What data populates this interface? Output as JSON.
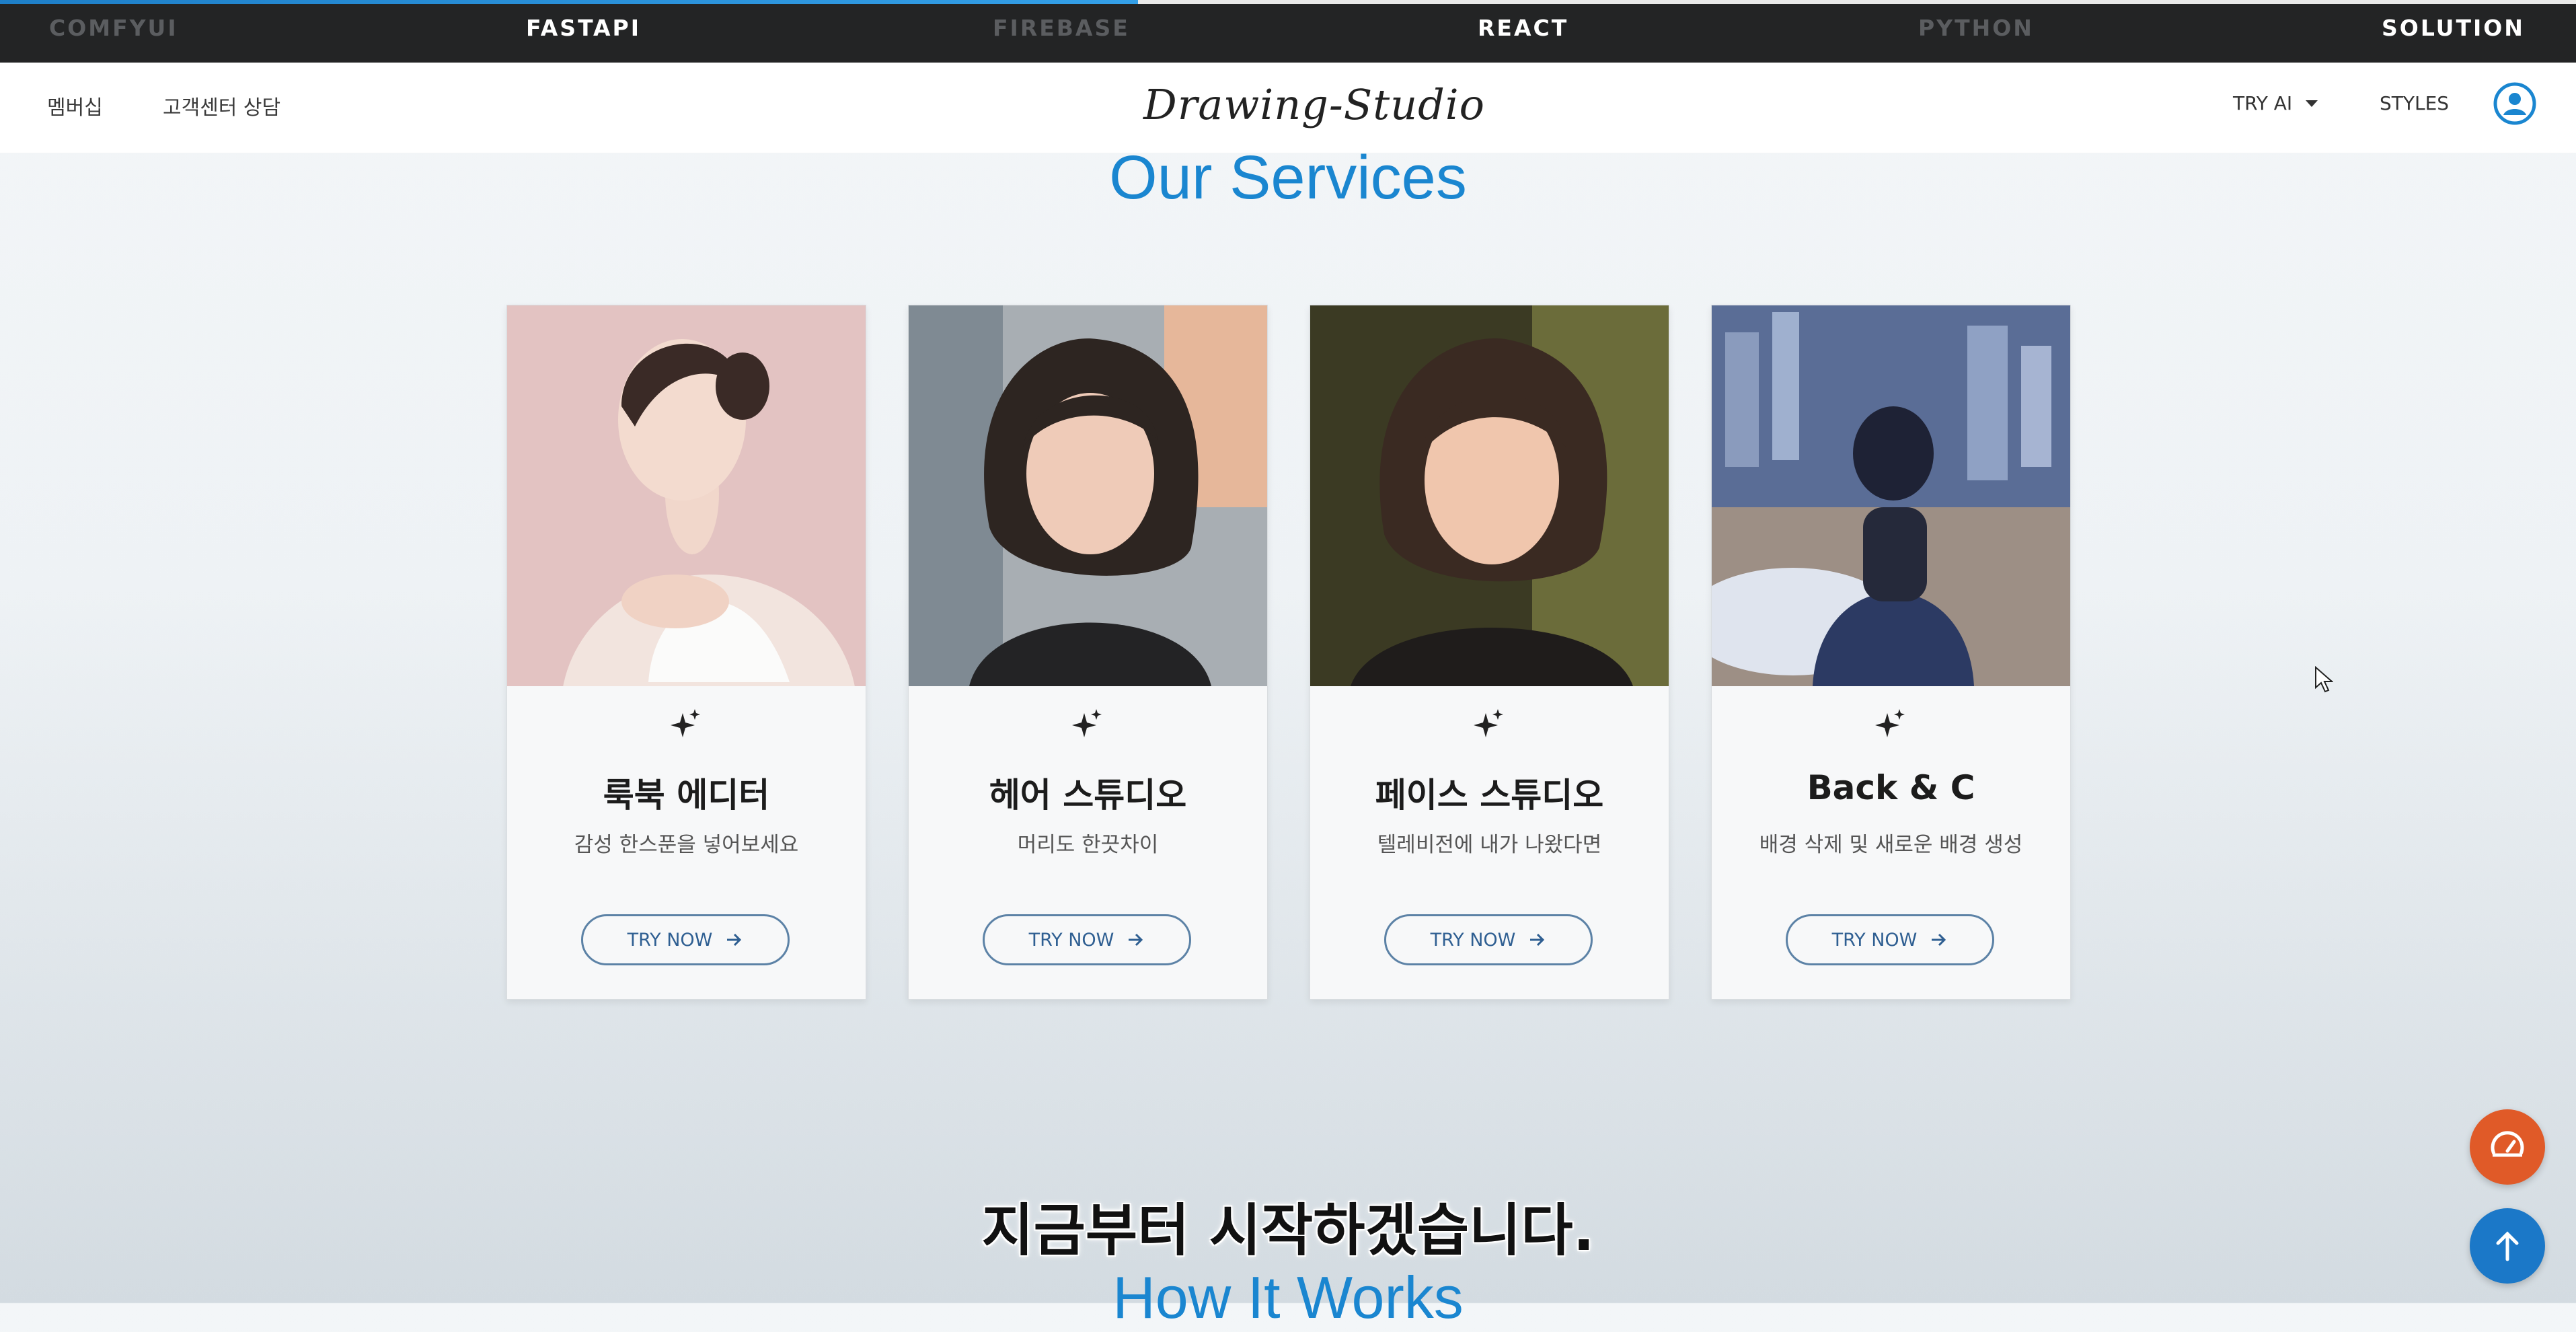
{
  "techbar": {
    "items": [
      {
        "label": "COMFYUI",
        "active": false
      },
      {
        "label": "FASTAPI",
        "active": true
      },
      {
        "label": "FIREBASE",
        "active": false
      },
      {
        "label": "REACT",
        "active": true
      },
      {
        "label": "PYTHON",
        "active": false
      },
      {
        "label": "SOLUTION",
        "active": true
      }
    ],
    "progress_percent": 44
  },
  "header": {
    "nav": [
      "멤버십",
      "고객센터 상담"
    ],
    "logo": "Drawing-Studio",
    "try_ai": "TRY AI",
    "styles": "STYLES",
    "account_icon": "account-circle-icon"
  },
  "services": {
    "title": "Our Services",
    "cards": [
      {
        "title": "룩북 에디터",
        "desc": "감성 한스푼을 넣어보세요",
        "button": "TRY NOW",
        "image": "woman-white-dress-pink-background"
      },
      {
        "title": "헤어 스튜디오",
        "desc": "머리도 한끗차이",
        "button": "TRY NOW",
        "image": "woman-bob-hair-street"
      },
      {
        "title": "페이스 스튜디오",
        "desc": "텔레비전에 내가 나왔다면",
        "button": "TRY NOW",
        "image": "woman-short-hair-warm-light"
      },
      {
        "title": "Back & C",
        "desc": "배경 삭제 및 새로운 배경 생성",
        "button": "TRY NOW",
        "image": "man-sitting-overlooking-city"
      }
    ]
  },
  "subtitle_caption": "지금부터 시작하겠습니다.",
  "next_section_title": "How It Works",
  "colors": {
    "accent": "#1a86d0",
    "fab_orange": "#e05a28",
    "fab_blue": "#1b78c8",
    "button_border": "#5c82a6"
  }
}
